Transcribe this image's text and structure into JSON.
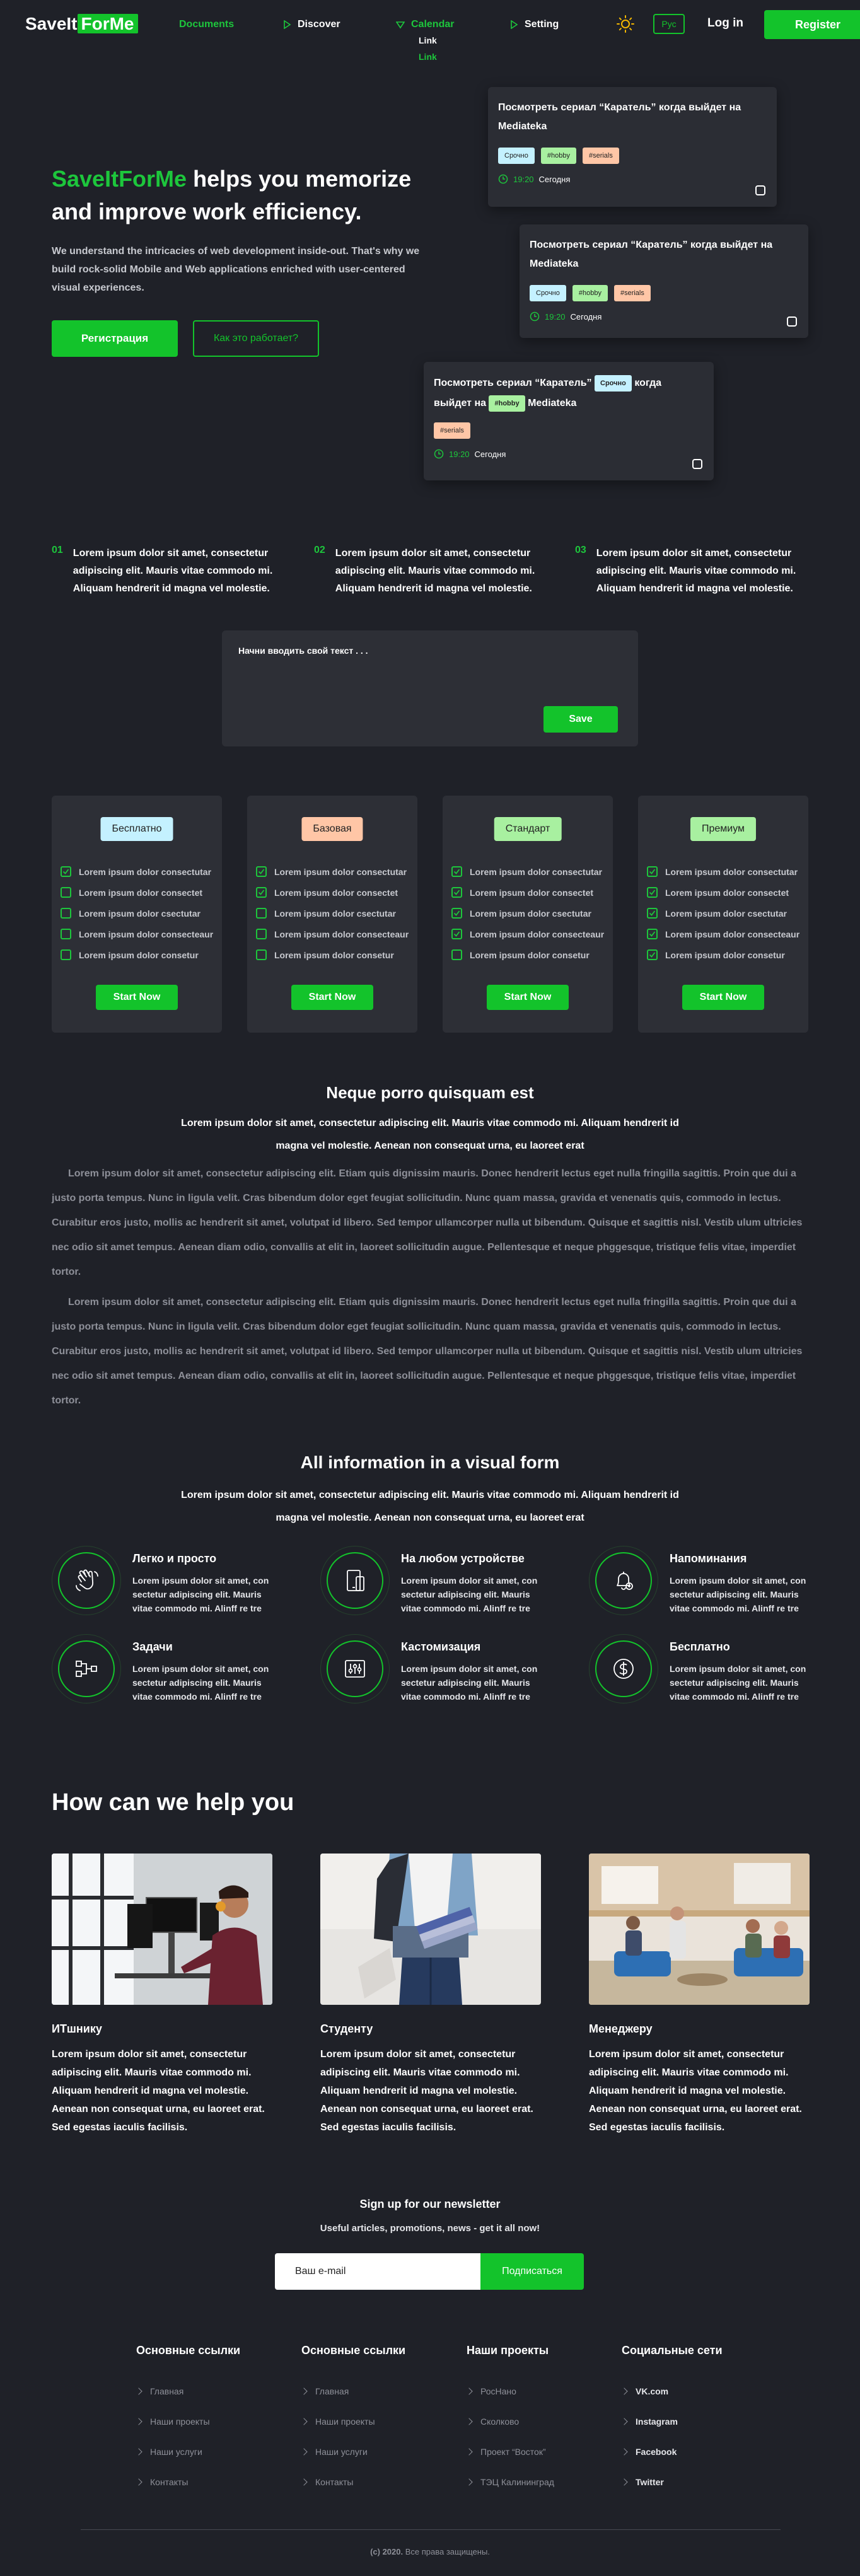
{
  "nav": {
    "logo_a": "SaveIt",
    "logo_b": "ForMe",
    "items": [
      "Documents",
      "Discover",
      "Calendar",
      "Setting"
    ],
    "calendar_sub": [
      "Link",
      "Link"
    ],
    "lang": "Рус",
    "login": "Log in",
    "register": "Register"
  },
  "hero": {
    "title_brand": "SaveItForMe",
    "title_rest": " helps you memorize and improve work efficiency.",
    "desc": "We understand the intricacies of web development inside-out. That's why we build rock-solid Mobile and Web applications enriched with user-centered visual experiences.",
    "btn_primary": "Регистрация",
    "btn_secondary": "Как это работает?"
  },
  "tasks": [
    {
      "title": "Посмотреть сериал “Каратель” когда выйдет на Mediateka",
      "tags": [
        "Срочно",
        "#hobby",
        "#serials"
      ],
      "time": "19:20",
      "day": "Сегодня"
    },
    {
      "title": "Посмотреть сериал “Каратель” когда выйдет на Mediateka",
      "tags": [
        "Срочно",
        "#hobby",
        "#serials"
      ],
      "time": "19:20",
      "day": "Сегодня"
    },
    {
      "title_a": "Посмотреть сериал “Каратель”",
      "title_b": "когда",
      "title_c": "выйдет на",
      "title_d": "Mediateka",
      "tags": [
        "Срочно",
        "#hobby",
        "#serials"
      ],
      "time": "19:20",
      "day": "Сегодня"
    }
  ],
  "steps": [
    {
      "num": "01",
      "text": "Lorem ipsum dolor sit amet, consectetur adipiscing elit. Mauris vitae commodo mi. Aliquam hendrerit id magna vel molestie."
    },
    {
      "num": "02",
      "text": "Lorem ipsum dolor sit amet, consectetur adipiscing elit. Mauris vitae commodo mi. Aliquam hendrerit id magna vel molestie."
    },
    {
      "num": "03",
      "text": "Lorem ipsum dolor sit amet, consectetur adipiscing elit. Mauris vitae commodo mi. Aliquam hendrerit id magna vel molestie."
    }
  ],
  "textbox": {
    "placeholder": "Начни вводить свой текст . . .",
    "save": "Save"
  },
  "plans": [
    {
      "name": "Бесплатно",
      "color": "#c4f1ff",
      "checked": 1,
      "button": "Start Now"
    },
    {
      "name": "Базовая",
      "color": "#ffc6a6",
      "checked": 2,
      "button": "Start Now"
    },
    {
      "name": "Стандарт",
      "color": "#a8f0a0",
      "checked": 4,
      "button": "Start Now"
    },
    {
      "name": "Премиум",
      "color": "#a8f0a0",
      "checked": 5,
      "button": "Start Now"
    }
  ],
  "plan_features": [
    "Lorem ipsum dolor consectutar",
    "Lorem ipsum dolor consectet",
    "Lorem ipsum dolor csectutar",
    "Lorem ipsum dolor consecteaur",
    "Lorem ipsum dolor consetur"
  ],
  "article": {
    "title": "Neque porro quisquam est",
    "lead": "Lorem ipsum dolor sit amet, consectetur adipiscing elit. Mauris vitae commodo mi. Aliquam hendrerit id magna vel molestie. Aenean non consequat urna, eu laoreet erat",
    "p1": "Lorem ipsum dolor sit amet, consectetur adipiscing elit. Etiam quis dignissim mauris. Donec hendrerit lectus eget nulla fringilla sagittis. Proin que dui a justo porta tempus. Nunc in ligula velit. Cras bibendum dolor eget feugiat sollicitudin. Nunc quam massa, gravida et venenatis quis, commodo in lectus. Curabitur eros justo, mollis ac hendrerit sit amet, volutpat id libero. Sed tempor ullamcorper nulla ut bibendum. Quisque et sagittis nisl. Vestib ulum ultricies nec odio sit amet tempus. Aenean diam odio, convallis at elit in, laoreet sollicitudin augue. Pellentesque et neque phggesque, tristique felis vitae, imperdiet tortor.",
    "p2": "Lorem ipsum dolor sit amet, consectetur adipiscing elit. Etiam quis dignissim mauris. Donec hendrerit lectus eget nulla fringilla sagittis. Proin que dui a justo porta tempus. Nunc in ligula velit. Cras bibendum dolor eget feugiat sollicitudin. Nunc quam massa, gravida et venenatis quis, commodo in lectus. Curabitur eros justo, mollis ac hendrerit sit amet, volutpat id libero. Sed tempor ullamcorper nulla ut bibendum. Quisque et sagittis nisl. Vestib ulum ultricies nec odio sit amet tempus. Aenean diam odio, convallis at elit in, laoreet sollicitudin augue. Pellentesque et neque phggesque, tristique felis vitae, imperdiet tortor."
  },
  "visual": {
    "title": "All information in a visual form",
    "lead": "Lorem ipsum dolor sit amet, consectetur adipiscing elit. Mauris vitae commodo mi. Aliquam hendrerit id magna vel molestie. Aenean non consequat urna, eu laoreet erat"
  },
  "features": [
    {
      "icon": "hand-wave-icon",
      "title": "Легко и просто",
      "desc": "Lorem ipsum dolor sit amet, con sectetur adipiscing elit. Mauris vitae commodo mi. Alinff re tre"
    },
    {
      "icon": "devices-icon",
      "title": "На любом устройстве",
      "desc": "Lorem ipsum dolor sit amet, con sectetur adipiscing elit. Mauris vitae commodo mi. Alinff re tre"
    },
    {
      "icon": "bell-icon",
      "title": "Напоминания",
      "desc": "Lorem ipsum dolor sit amet, con sectetur adipiscing elit. Mauris vitae commodo mi. Alinff re tre"
    },
    {
      "icon": "tasks-flow-icon",
      "title": "Задачи",
      "desc": "Lorem ipsum dolor sit amet, con sectetur adipiscing elit. Mauris vitae commodo mi. Alinff re tre"
    },
    {
      "icon": "customize-icon",
      "title": "Кастомизация",
      "desc": "Lorem ipsum dolor sit amet, con sectetur adipiscing elit. Mauris vitae commodo mi. Alinff re tre"
    },
    {
      "icon": "dollar-icon",
      "title": "Бесплатно",
      "desc": "Lorem ipsum dolor sit amet, con sectetur adipiscing elit. Mauris vitae commodo mi. Alinff re tre"
    }
  ],
  "help": {
    "title": "How can we help you",
    "cards": [
      {
        "title": "ИТшнику",
        "desc": "Lorem ipsum dolor sit amet, consectetur adipiscing elit. Mauris vitae commodo mi. Aliquam hendrerit id magna vel molestie. Aenean non consequat urna, eu laoreet erat. Sed egestas iaculis facilisis."
      },
      {
        "title": "Студенту",
        "desc": "Lorem ipsum dolor sit amet, consectetur adipiscing elit. Mauris vitae commodo mi. Aliquam hendrerit id magna vel molestie. Aenean non consequat urna, eu laoreet erat. Sed egestas iaculis facilisis."
      },
      {
        "title": "Менеджеру",
        "desc": "Lorem ipsum dolor sit amet, consectetur adipiscing elit. Mauris vitae commodo mi. Aliquam hendrerit id magna vel molestie. Aenean non consequat urna, eu laoreet erat. Sed egestas iaculis facilisis."
      }
    ]
  },
  "newsletter": {
    "title": "Sign up for our newsletter",
    "sub": "Useful articles, promotions, news - get it all now!",
    "placeholder": "Ваш e-mail",
    "button": "Подписаться"
  },
  "footer": {
    "cols": [
      {
        "title": "Основные ссылки",
        "links": [
          "Главная",
          "Наши проекты",
          "Наши услуги",
          "Контакты"
        ]
      },
      {
        "title": "Основные ссылки",
        "links": [
          "Главная",
          "Наши проекты",
          "Наши услуги",
          "Контакты"
        ]
      },
      {
        "title": "Наши проекты",
        "links": [
          "РосНано",
          "Сколково",
          "Проект “Восток”",
          "ТЭЦ Калининград"
        ]
      },
      {
        "title": "Социальные сети",
        "links": [
          "VK.com",
          "Instagram",
          "Facebook",
          "Twitter"
        ]
      }
    ],
    "copy_year": "(c) 2020.",
    "copy_text": "Все права защищены."
  }
}
